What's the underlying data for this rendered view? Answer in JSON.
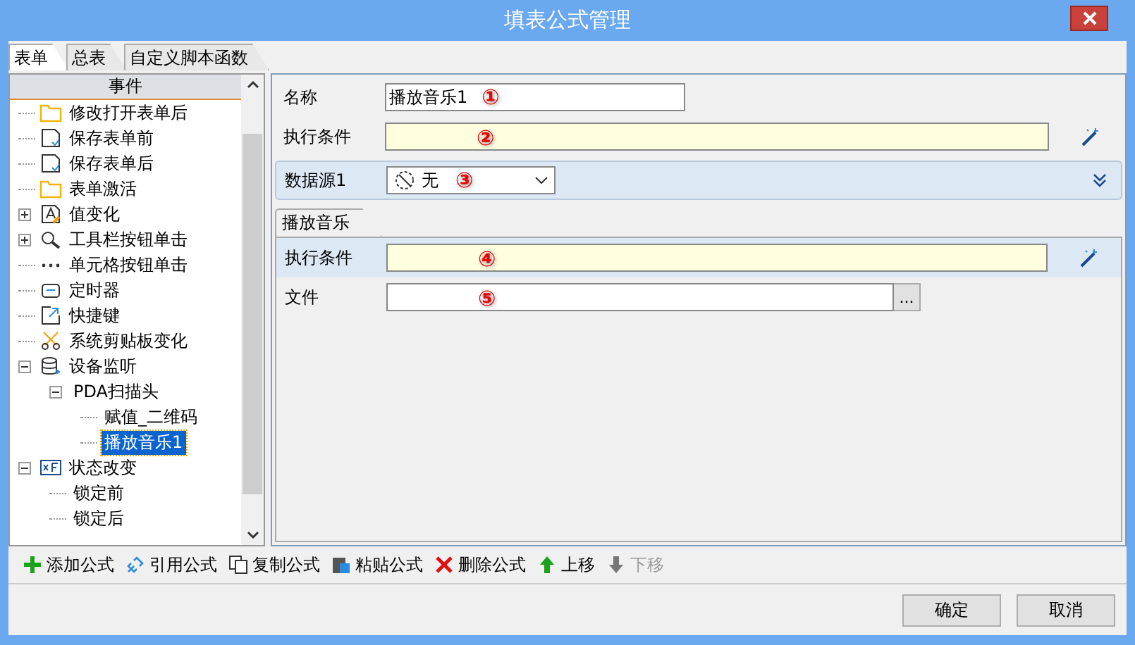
{
  "window": {
    "title": "填表公式管理"
  },
  "tabs": [
    {
      "label": "表单",
      "selected": true
    },
    {
      "label": "总表",
      "selected": false
    },
    {
      "label": "自定义脚本函数",
      "selected": false
    }
  ],
  "tree": {
    "header": "事件",
    "items": [
      {
        "label": "修改打开表单后",
        "kind": "folder",
        "selected": false
      },
      {
        "label": "保存表单前",
        "kind": "save",
        "selected": false
      },
      {
        "label": "保存表单后",
        "kind": "save",
        "selected": false
      },
      {
        "label": "表单激活",
        "kind": "folder",
        "selected": false
      },
      {
        "label": "值变化",
        "kind": "edit",
        "expanded": false,
        "selected": false
      },
      {
        "label": "工具栏按钮单击",
        "kind": "search",
        "expanded": false,
        "selected": false
      },
      {
        "label": "单元格按钮单击",
        "kind": "dots",
        "selected": false
      },
      {
        "label": "定时器",
        "kind": "timer",
        "selected": false
      },
      {
        "label": "快捷键",
        "kind": "shortcut",
        "selected": false
      },
      {
        "label": "系统剪贴板变化",
        "kind": "scissors",
        "selected": false
      },
      {
        "label": "设备监听",
        "kind": "device",
        "expanded": true,
        "selected": false,
        "children": [
          {
            "label": "PDA扫描头",
            "expanded": true,
            "selected": false,
            "children": [
              {
                "label": "赋值_二维码",
                "selected": false
              },
              {
                "label": "播放音乐1",
                "selected": true
              }
            ]
          }
        ]
      },
      {
        "label": "状态改变",
        "kind": "form",
        "expanded": true,
        "selected": false,
        "children": [
          {
            "label": "锁定前",
            "selected": false
          },
          {
            "label": "锁定后",
            "selected": false
          }
        ]
      }
    ]
  },
  "form": {
    "name_label": "名称",
    "name_value": "播放音乐1",
    "name_note": "①",
    "condition_label": "执行条件",
    "condition_note": "②",
    "source_label": "数据源1",
    "source_value": "无",
    "source_note": "③",
    "sub_tab": "播放音乐",
    "sub_condition_label": "执行条件",
    "sub_condition_note": "④",
    "file_label": "文件",
    "file_note": "⑤",
    "browse": "..."
  },
  "toolbar": [
    {
      "label": "添加公式",
      "kind": "add",
      "disabled": false
    },
    {
      "label": "引用公式",
      "kind": "link",
      "disabled": false
    },
    {
      "label": "复制公式",
      "kind": "copy",
      "disabled": false
    },
    {
      "label": "粘贴公式",
      "kind": "paste",
      "disabled": false
    },
    {
      "label": "删除公式",
      "kind": "delete",
      "disabled": false
    },
    {
      "label": "上移",
      "kind": "up",
      "disabled": false
    },
    {
      "label": "下移",
      "kind": "down",
      "disabled": true
    }
  ],
  "buttons": [
    "确定",
    "取消"
  ]
}
